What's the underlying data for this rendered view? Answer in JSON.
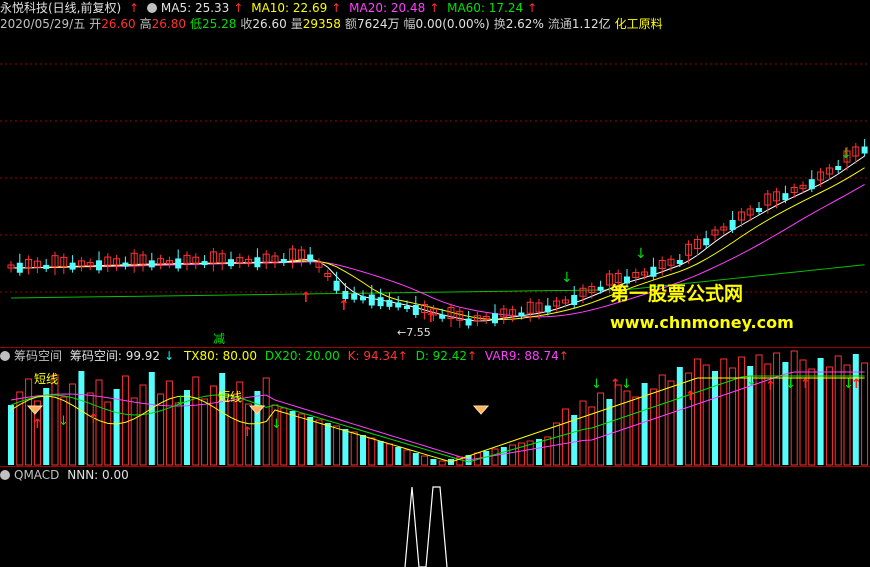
{
  "header": {
    "title": "永悦科技(日线,前复权)",
    "ma5": "MA5: 25.33",
    "ma10": "MA10: 22.69",
    "ma20": "MA20: 20.48",
    "ma60": "MA60: 17.24"
  },
  "info": {
    "date": "2020/05/29/五",
    "open_label": "开",
    "open": "26.60",
    "high_label": "高",
    "high": "26.80",
    "low_label": "低",
    "low": "25.28",
    "close_label": "收",
    "close": "26.60",
    "vol_label": "量",
    "vol": "29358",
    "amt_label": "额",
    "amt": "7624万",
    "chg_label": "幅",
    "chg": "0.00(0.00%)",
    "turn_label": "换",
    "turn": "2.62%",
    "float_label": "流通",
    "float": "1.12亿",
    "sector": "化工原料"
  },
  "main_chart": {
    "low_marker": "←7.55",
    "reduce_tag": "减",
    "watermark_cn": "第一股票公式网",
    "watermark_url": "www.chnmoney.com",
    "colors": {
      "up": "#ff3232",
      "down": "#54fcfc",
      "ma5": "#ffffff",
      "ma10": "#ffff00",
      "ma20": "#ff40ff",
      "ma60": "#00c000"
    }
  },
  "indicator1": {
    "name": "筹码空间",
    "value": "筹码空间: 99.92",
    "tx80": "TX80: 80.00",
    "dx20": "DX20: 20.00",
    "k": "K: 94.34",
    "d": "D: 92.42",
    "var9": "VAR9: 88.74",
    "tag_short": "短线",
    "tag_short2": "短线"
  },
  "indicator2": {
    "name": "QMACD",
    "nnn": "NNN: 0.00"
  }
}
